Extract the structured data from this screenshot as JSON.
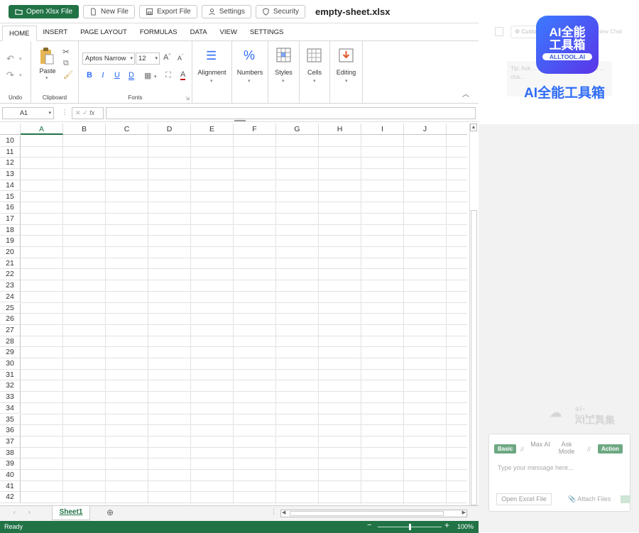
{
  "toolbar": {
    "open_label": "Open Xlsx File",
    "new_label": "New File",
    "export_label": "Export File",
    "settings_label": "Settings",
    "security_label": "Security",
    "filename": "empty-sheet.xlsx"
  },
  "ribbon": {
    "tabs": [
      "HOME",
      "INSERT",
      "PAGE LAYOUT",
      "FORMULAS",
      "DATA",
      "VIEW",
      "SETTINGS"
    ],
    "active_tab": "HOME",
    "undo_group": "Undo",
    "clipboard_group": "Clipboard",
    "paste_label": "Paste",
    "fonts_group": "Fonts",
    "font_name": "Aptos Narrow",
    "font_size": "12",
    "alignment_label": "Alignment",
    "numbers_label": "Numbers",
    "styles_label": "Styles",
    "cells_label": "Cells",
    "editing_label": "Editing"
  },
  "formula_bar": {
    "cell_ref": "A1",
    "fx": "fx",
    "formula": ""
  },
  "grid": {
    "columns": [
      "A",
      "B",
      "C",
      "D",
      "E",
      "F",
      "G",
      "H",
      "I",
      "J"
    ],
    "selected_column": "A",
    "rows": [
      "10",
      "11",
      "12",
      "13",
      "14",
      "15",
      "16",
      "17",
      "18",
      "19",
      "20",
      "21",
      "22",
      "23",
      "24",
      "25",
      "26",
      "27",
      "28",
      "29",
      "30",
      "31",
      "32",
      "33",
      "34",
      "35",
      "36",
      "37",
      "38",
      "39",
      "40",
      "41",
      "42"
    ]
  },
  "sheets": {
    "active": "Sheet1"
  },
  "status": {
    "text": "Ready",
    "zoom": "100%",
    "zoom_fraction": 0.5
  },
  "side_panel": {
    "new_chat": "New Chat",
    "custom": "Custo",
    "tip": "Tip: Ask ... work for ... Most ... 3-15 ... cha...",
    "logo_top": "AI全能",
    "logo_mid": "工具箱",
    "logo_site": "ALLTOOL.AI",
    "logo_caption": "AI全能工具箱",
    "watermark_site": "ai-bot.cn",
    "watermark_name": "AI工具集",
    "modes": [
      "Basic",
      "Max AI",
      "Ask Mode",
      "Action"
    ],
    "placeholder": "Type your message here...",
    "open_excel_label": "Open Excel File",
    "attach_label": "Attach Files"
  },
  "colors": {
    "brand": "#217346",
    "mode_badge": "#6da883",
    "logo_blue": "#2f6cf6"
  }
}
